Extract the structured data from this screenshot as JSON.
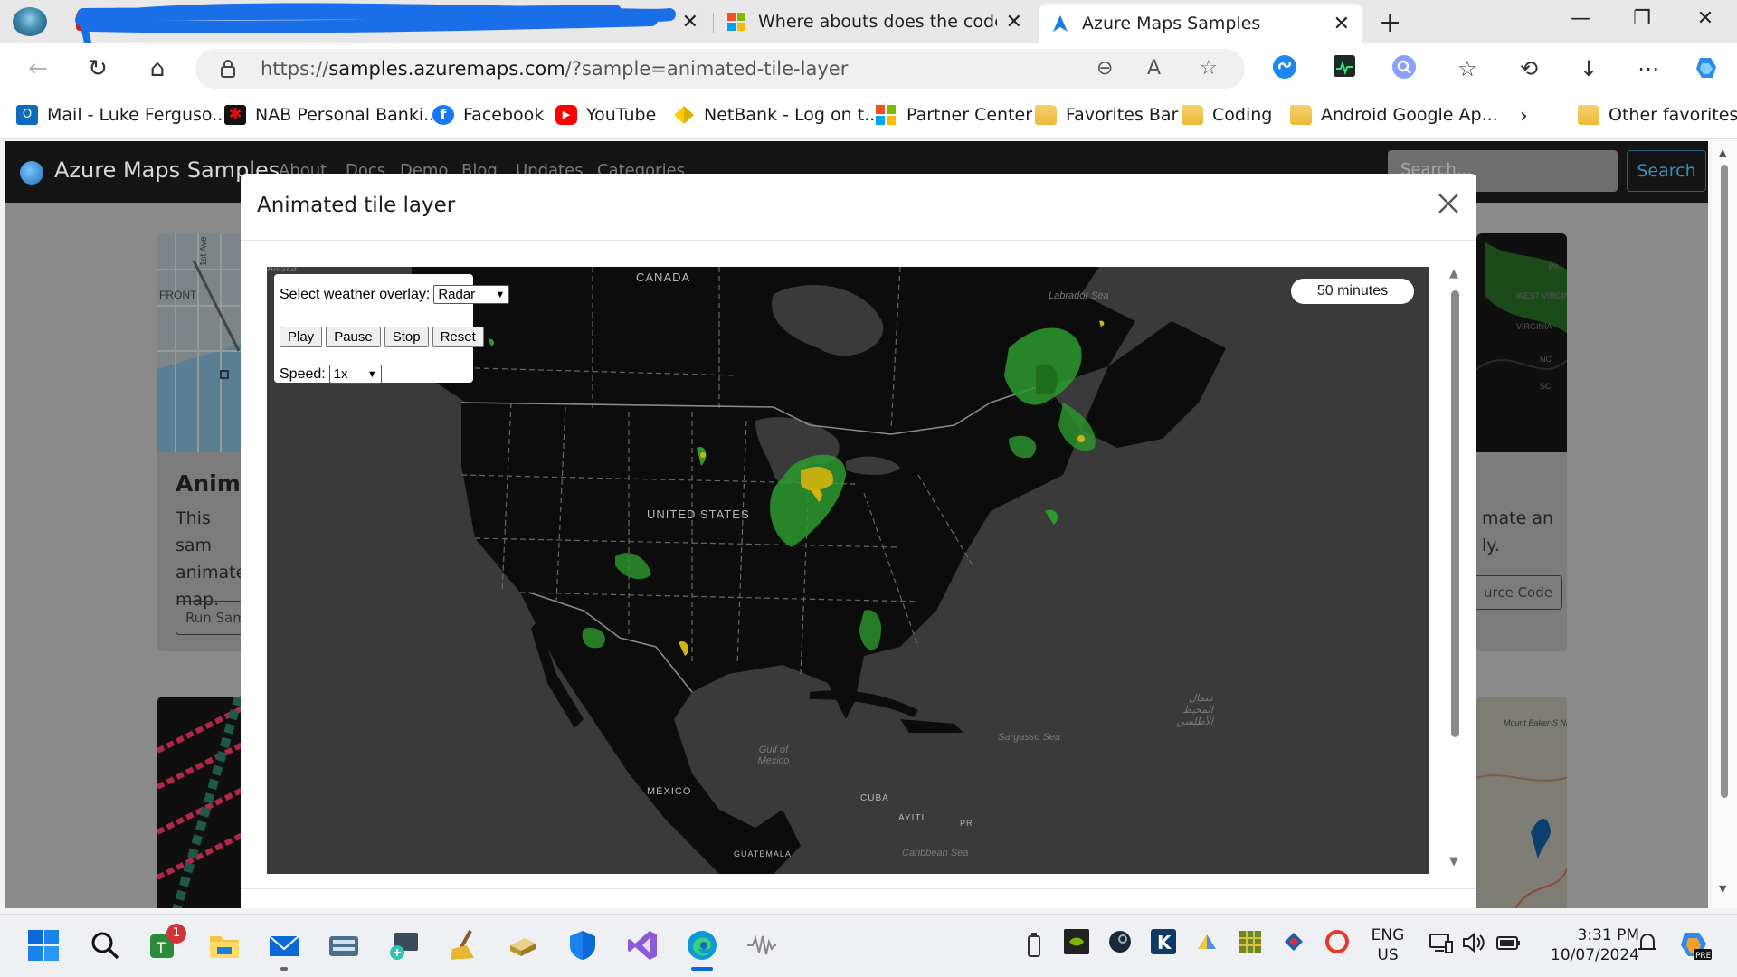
{
  "browser": {
    "tabs": [
      {
        "title": "",
        "redacted": true
      },
      {
        "title": "",
        "redacted": true
      },
      {
        "title": "Where abouts does the code go"
      },
      {
        "title": "Azure Maps Samples",
        "active": true
      }
    ],
    "url_prefix": "https://",
    "url_host": "samples.azuremaps.com",
    "url_path": "/?sample=animated-tile-layer",
    "favorites": [
      {
        "label": "Mail - Luke Ferguso...",
        "icon": "outlook-icon"
      },
      {
        "label": "NAB Personal Banki...",
        "icon": "nab-icon"
      },
      {
        "label": "Facebook",
        "icon": "facebook-icon"
      },
      {
        "label": "YouTube",
        "icon": "youtube-icon"
      },
      {
        "label": "NetBank - Log on t...",
        "icon": "netbank-icon"
      },
      {
        "label": "Partner Center",
        "icon": "microsoft-icon"
      },
      {
        "label": "Favorites Bar",
        "icon": "folder-icon"
      },
      {
        "label": "Coding",
        "icon": "folder-icon"
      },
      {
        "label": "Android Google Ap...",
        "icon": "folder-icon"
      }
    ],
    "other_favorites": "Other favorites"
  },
  "site": {
    "title": "Azure Maps Samples",
    "nav": [
      "About",
      "Docs",
      "Demo",
      "Blog",
      "Updates",
      "Categories"
    ],
    "search_placeholder": "Search...",
    "search_button": "Search"
  },
  "cards": {
    "left_title": "Anima",
    "left_text": [
      "This sam",
      "animate",
      "map."
    ],
    "left_button": "Run Samp",
    "right_text": [
      "mate an",
      "ly."
    ],
    "right_button": "urce Code"
  },
  "modal": {
    "title": "Animated tile layer"
  },
  "map": {
    "overlay_label": "Select weather overlay:",
    "overlay_value": "Radar",
    "buttons": [
      "Play",
      "Pause",
      "Stop",
      "Reset"
    ],
    "speed_label": "Speed:",
    "speed_value": "1x",
    "time_display": "50 minutes",
    "labels": {
      "canada": "CANADA",
      "usa": "UNITED STATES",
      "mexico": "MÉXICO",
      "cuba": "CUBA",
      "haiti": "AYITI",
      "gulf": "Gulf of Mexico",
      "sargasso": "Sargasso Sea",
      "labrador": "Labrador Sea",
      "caribbean": "Caribbean Sea",
      "guatemala": "GUATEMALA",
      "alaska": "Alaska",
      "pr": "PR",
      "atlantic_ar": "شمال المحيط الأطلسي"
    }
  },
  "thumb_labels": {
    "front": "FRONT",
    "ave": "1st Ave",
    "west_virginia": "WEST VIRGINIA",
    "virginia": "VIRGINIA",
    "nc": "NC",
    "sc": "SC",
    "pa": "PA",
    "mount": "Mount Baker-S National"
  },
  "taskbar": {
    "badge": "1",
    "lang": "ENG",
    "region": "US",
    "time": "3:31 PM",
    "date": "10/07/2024"
  },
  "colors": {
    "accent": "#0078d4",
    "map_land": "#0c0c0c",
    "map_water": "#3a3a3a",
    "radar_green": "#2e9a2e",
    "radar_yellow": "#d6b20c"
  }
}
